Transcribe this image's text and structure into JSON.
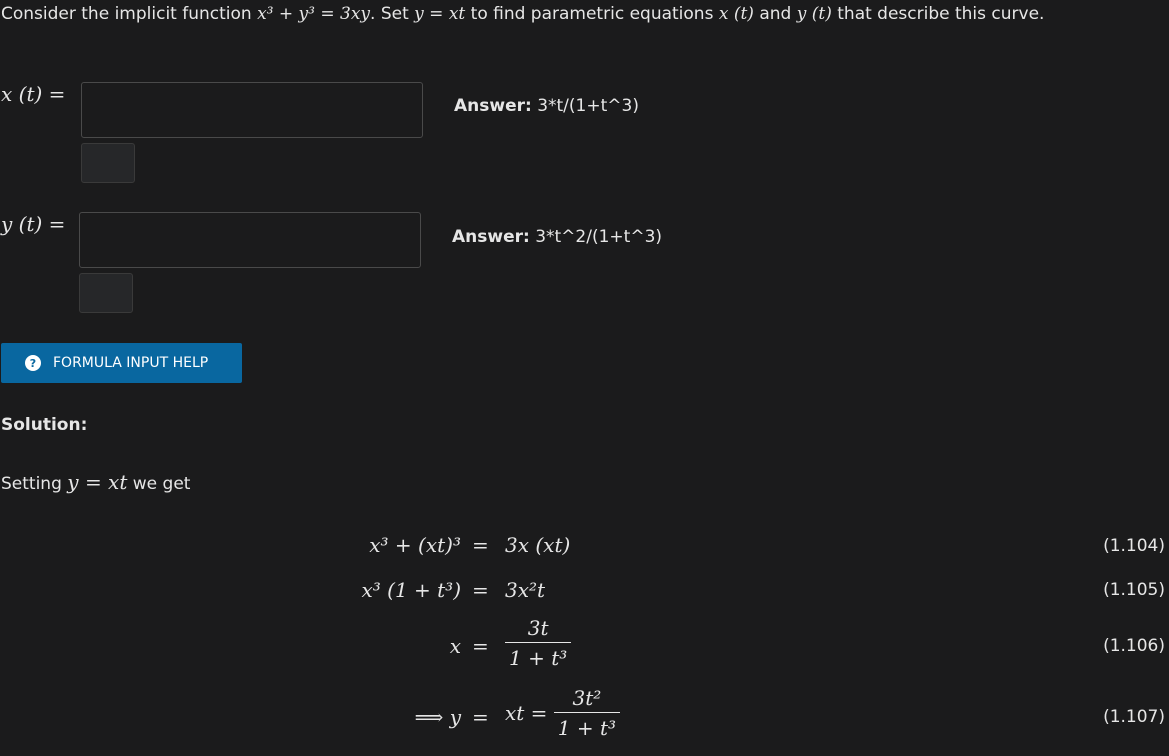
{
  "question": {
    "text_before": "Consider the implicit function ",
    "eq_implicit": "x³ + y³ = 3xy",
    "text_mid1": ". Set ",
    "eq_sub": "y = xt",
    "text_mid2": " to find parametric equations ",
    "x_t": "x (t)",
    "text_and": " and ",
    "y_t": "y (t)",
    "text_after": " that describe this curve."
  },
  "fields": {
    "x_label": "x (t) =",
    "y_label": "y (t) =",
    "x_answer_prefix": "Answer:",
    "x_answer": "3*t/(1+t^3)",
    "y_answer_prefix": "Answer:",
    "y_answer": "3*t^2/(1+t^3)"
  },
  "help_button": {
    "icon": "?",
    "label": "FORMULA INPUT HELP"
  },
  "solution": {
    "heading": "Solution:",
    "intro_before": "Setting ",
    "intro_eq": "y = xt",
    "intro_after": " we get",
    "equations": [
      {
        "lhs": "x³ + (xt)³",
        "rhs": "3x (xt)",
        "number": "(1.104)"
      },
      {
        "lhs": "x³ (1 + t³)",
        "rhs": "3x²t",
        "number": "(1.105)"
      },
      {
        "lhs": "x",
        "rhs_num": "3t",
        "rhs_den": "1 + t³",
        "number": "(1.106)"
      },
      {
        "lhs": "⟹ y",
        "rhs_prefix": "xt =",
        "rhs_num": "3t²",
        "rhs_den": "1 + t³",
        "number": "(1.107)"
      }
    ]
  }
}
